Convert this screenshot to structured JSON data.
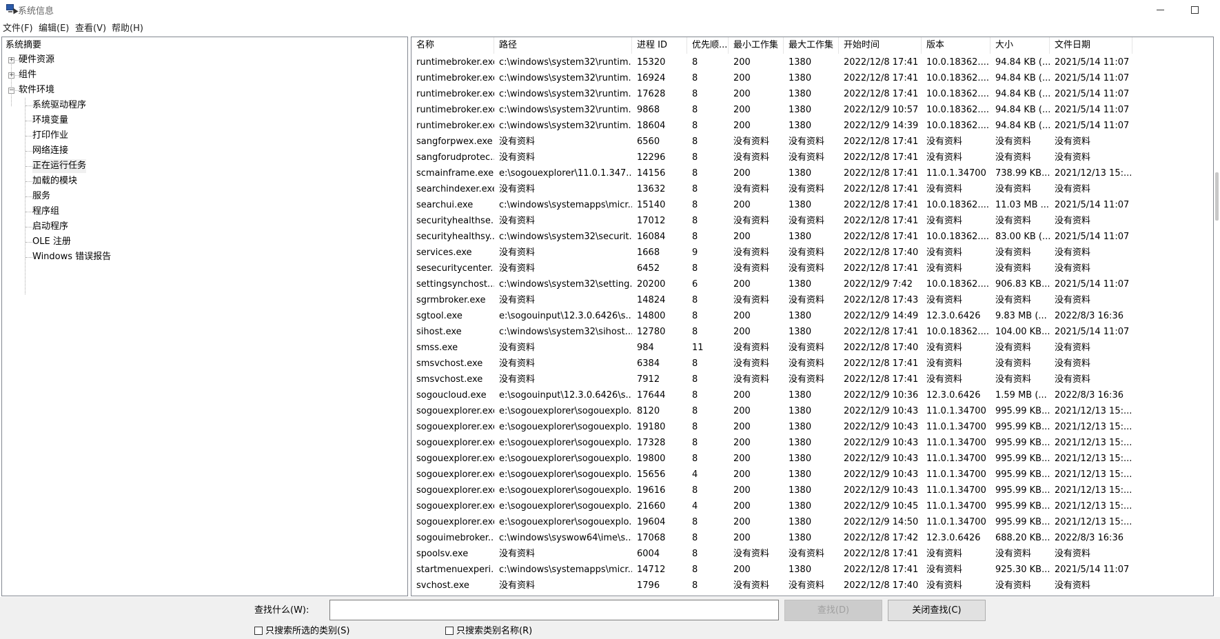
{
  "window": {
    "title": "系统信息"
  },
  "menu": [
    "文件(F)",
    "编辑(E)",
    "查看(V)",
    "帮助(H)"
  ],
  "tree": {
    "root": "系统摘要",
    "nodes": [
      {
        "label": "硬件资源",
        "expander": "+"
      },
      {
        "label": "组件",
        "expander": "+"
      },
      {
        "label": "软件环境",
        "expander": "−"
      }
    ],
    "children": [
      "系统驱动程序",
      "环境变量",
      "打印作业",
      "网络连接",
      "正在运行任务",
      "加载的模块",
      "服务",
      "程序组",
      "启动程序",
      "OLE 注册",
      "Windows 错误报告"
    ],
    "selected": "正在运行任务"
  },
  "columns": [
    "名称",
    "路径",
    "进程 ID",
    "优先顺...",
    "最小工作集",
    "最大工作集",
    "开始时间",
    "版本",
    "大小",
    "文件日期"
  ],
  "rows": [
    [
      "runtimebroker.exe",
      "c:\\windows\\system32\\runtim...",
      "15320",
      "8",
      "200",
      "1380",
      "2022/12/8 17:41",
      "10.0.18362....",
      "94.84 KB (...",
      "2021/5/14 11:07"
    ],
    [
      "runtimebroker.exe",
      "c:\\windows\\system32\\runtim...",
      "16924",
      "8",
      "200",
      "1380",
      "2022/12/8 17:41",
      "10.0.18362....",
      "94.84 KB (...",
      "2021/5/14 11:07"
    ],
    [
      "runtimebroker.exe",
      "c:\\windows\\system32\\runtim...",
      "17628",
      "8",
      "200",
      "1380",
      "2022/12/8 17:41",
      "10.0.18362....",
      "94.84 KB (...",
      "2021/5/14 11:07"
    ],
    [
      "runtimebroker.exe",
      "c:\\windows\\system32\\runtim...",
      "9868",
      "8",
      "200",
      "1380",
      "2022/12/9 10:57",
      "10.0.18362....",
      "94.84 KB (...",
      "2021/5/14 11:07"
    ],
    [
      "runtimebroker.exe",
      "c:\\windows\\system32\\runtim...",
      "18604",
      "8",
      "200",
      "1380",
      "2022/12/9 14:39",
      "10.0.18362....",
      "94.84 KB (...",
      "2021/5/14 11:07"
    ],
    [
      "sangforpwex.exe",
      "没有资料",
      "6560",
      "8",
      "没有资料",
      "没有资料",
      "2022/12/8 17:41",
      "没有资料",
      "没有资料",
      "没有资料"
    ],
    [
      "sangforudprotec...",
      "没有资料",
      "12296",
      "8",
      "没有资料",
      "没有资料",
      "2022/12/8 17:41",
      "没有资料",
      "没有资料",
      "没有资料"
    ],
    [
      "scmainframe.exe",
      "e:\\sogouexplorer\\11.0.1.347...",
      "14156",
      "8",
      "200",
      "1380",
      "2022/12/8 17:41",
      "11.0.1.34700",
      "738.99 KB...",
      "2021/12/13 15:..."
    ],
    [
      "searchindexer.exe",
      "没有资料",
      "13632",
      "8",
      "没有资料",
      "没有资料",
      "2022/12/8 17:41",
      "没有资料",
      "没有资料",
      "没有资料"
    ],
    [
      "searchui.exe",
      "c:\\windows\\systemapps\\micr...",
      "15140",
      "8",
      "200",
      "1380",
      "2022/12/8 17:41",
      "10.0.18362....",
      "11.03 MB ...",
      "2021/5/14 11:07"
    ],
    [
      "securityhealthse...",
      "没有资料",
      "17012",
      "8",
      "没有资料",
      "没有资料",
      "2022/12/8 17:41",
      "没有资料",
      "没有资料",
      "没有资料"
    ],
    [
      "securityhealthsy...",
      "c:\\windows\\system32\\securit...",
      "16084",
      "8",
      "200",
      "1380",
      "2022/12/8 17:41",
      "10.0.18362....",
      "83.00 KB (...",
      "2021/5/14 11:07"
    ],
    [
      "services.exe",
      "没有资料",
      "1668",
      "9",
      "没有资料",
      "没有资料",
      "2022/12/8 17:40",
      "没有资料",
      "没有资料",
      "没有资料"
    ],
    [
      "sesecuritycenter....",
      "没有资料",
      "6452",
      "8",
      "没有资料",
      "没有资料",
      "2022/12/8 17:41",
      "没有资料",
      "没有资料",
      "没有资料"
    ],
    [
      "settingsynchost....",
      "c:\\windows\\system32\\setting...",
      "20200",
      "6",
      "200",
      "1380",
      "2022/12/9 7:42",
      "10.0.18362....",
      "906.83 KB...",
      "2021/5/14 11:07"
    ],
    [
      "sgrmbroker.exe",
      "没有资料",
      "14824",
      "8",
      "没有资料",
      "没有资料",
      "2022/12/8 17:43",
      "没有资料",
      "没有资料",
      "没有资料"
    ],
    [
      "sgtool.exe",
      "e:\\sogouinput\\12.3.0.6426\\s...",
      "14800",
      "8",
      "200",
      "1380",
      "2022/12/9 14:49",
      "12.3.0.6426",
      "9.83 MB (...",
      "2022/8/3 16:36"
    ],
    [
      "sihost.exe",
      "c:\\windows\\system32\\sihost....",
      "12780",
      "8",
      "200",
      "1380",
      "2022/12/8 17:41",
      "10.0.18362....",
      "104.00 KB...",
      "2021/5/14 11:07"
    ],
    [
      "smss.exe",
      "没有资料",
      "984",
      "11",
      "没有资料",
      "没有资料",
      "2022/12/8 17:40",
      "没有资料",
      "没有资料",
      "没有资料"
    ],
    [
      "smsvchost.exe",
      "没有资料",
      "6384",
      "8",
      "没有资料",
      "没有资料",
      "2022/12/8 17:41",
      "没有资料",
      "没有资料",
      "没有资料"
    ],
    [
      "smsvchost.exe",
      "没有资料",
      "7912",
      "8",
      "没有资料",
      "没有资料",
      "2022/12/8 17:41",
      "没有资料",
      "没有资料",
      "没有资料"
    ],
    [
      "sogoucloud.exe",
      "e:\\sogouinput\\12.3.0.6426\\s...",
      "17644",
      "8",
      "200",
      "1380",
      "2022/12/9 10:36",
      "12.3.0.6426",
      "1.59 MB (...",
      "2022/8/3 16:36"
    ],
    [
      "sogouexplorer.exe",
      "e:\\sogouexplorer\\sogouexplo...",
      "8120",
      "8",
      "200",
      "1380",
      "2022/12/9 10:43",
      "11.0.1.34700",
      "995.99 KB...",
      "2021/12/13 15:..."
    ],
    [
      "sogouexplorer.exe",
      "e:\\sogouexplorer\\sogouexplo...",
      "19180",
      "8",
      "200",
      "1380",
      "2022/12/9 10:43",
      "11.0.1.34700",
      "995.99 KB...",
      "2021/12/13 15:..."
    ],
    [
      "sogouexplorer.exe",
      "e:\\sogouexplorer\\sogouexplo...",
      "17328",
      "8",
      "200",
      "1380",
      "2022/12/9 10:43",
      "11.0.1.34700",
      "995.99 KB...",
      "2021/12/13 15:..."
    ],
    [
      "sogouexplorer.exe",
      "e:\\sogouexplorer\\sogouexplo...",
      "19800",
      "8",
      "200",
      "1380",
      "2022/12/9 10:43",
      "11.0.1.34700",
      "995.99 KB...",
      "2021/12/13 15:..."
    ],
    [
      "sogouexplorer.exe",
      "e:\\sogouexplorer\\sogouexplo...",
      "15656",
      "4",
      "200",
      "1380",
      "2022/12/9 10:43",
      "11.0.1.34700",
      "995.99 KB...",
      "2021/12/13 15:..."
    ],
    [
      "sogouexplorer.exe",
      "e:\\sogouexplorer\\sogouexplo...",
      "19616",
      "8",
      "200",
      "1380",
      "2022/12/9 10:43",
      "11.0.1.34700",
      "995.99 KB...",
      "2021/12/13 15:..."
    ],
    [
      "sogouexplorer.exe",
      "e:\\sogouexplorer\\sogouexplo...",
      "21660",
      "4",
      "200",
      "1380",
      "2022/12/9 10:45",
      "11.0.1.34700",
      "995.99 KB...",
      "2021/12/13 15:..."
    ],
    [
      "sogouexplorer.exe",
      "e:\\sogouexplorer\\sogouexplo...",
      "19604",
      "8",
      "200",
      "1380",
      "2022/12/9 14:50",
      "11.0.1.34700",
      "995.99 KB...",
      "2021/12/13 15:..."
    ],
    [
      "sogouimebroker....",
      "c:\\windows\\syswow64\\ime\\s...",
      "17068",
      "8",
      "200",
      "1380",
      "2022/12/8 17:42",
      "12.3.0.6426",
      "688.20 KB...",
      "2022/8/3 16:36"
    ],
    [
      "spoolsv.exe",
      "没有资料",
      "6004",
      "8",
      "没有资料",
      "没有资料",
      "2022/12/8 17:41",
      "没有资料",
      "没有资料",
      "没有资料"
    ],
    [
      "startmenuexperi...",
      "c:\\windows\\systemapps\\micr...",
      "14712",
      "8",
      "200",
      "1380",
      "2022/12/8 17:41",
      "没有资料",
      "925.30 KB...",
      "2021/5/14 11:07"
    ],
    [
      "svchost.exe",
      "没有资料",
      "1796",
      "8",
      "没有资料",
      "没有资料",
      "2022/12/8 17:40",
      "没有资料",
      "没有资料",
      "没有资料"
    ]
  ],
  "find": {
    "label": "查找什么(W):",
    "value": "",
    "find_button": "查找(D)",
    "close_button": "关闭查找(C)",
    "checkbox1": "只搜索所选的类别(S)",
    "checkbox2": "只搜索类别名称(R)"
  }
}
